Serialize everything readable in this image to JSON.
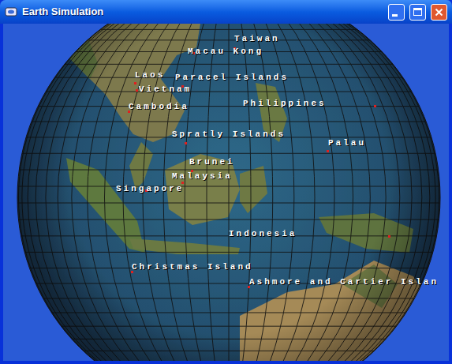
{
  "window": {
    "title": "Earth Simulation"
  },
  "places": [
    {
      "label": "Taiwan"
    },
    {
      "label": "Macau Kong"
    },
    {
      "label": "Laos"
    },
    {
      "label": "Paracel Islands"
    },
    {
      "label": "Vietnam"
    },
    {
      "label": "Cambodia"
    },
    {
      "label": "Philippines"
    },
    {
      "label": "Spratly Islands"
    },
    {
      "label": "Palau"
    },
    {
      "label": "Brunei"
    },
    {
      "label": "Malaysia"
    },
    {
      "label": "Singapore"
    },
    {
      "label": "Indonesia"
    },
    {
      "label": "Christmas Island"
    },
    {
      "label": "Ashmore and Cartier Islan"
    }
  ]
}
